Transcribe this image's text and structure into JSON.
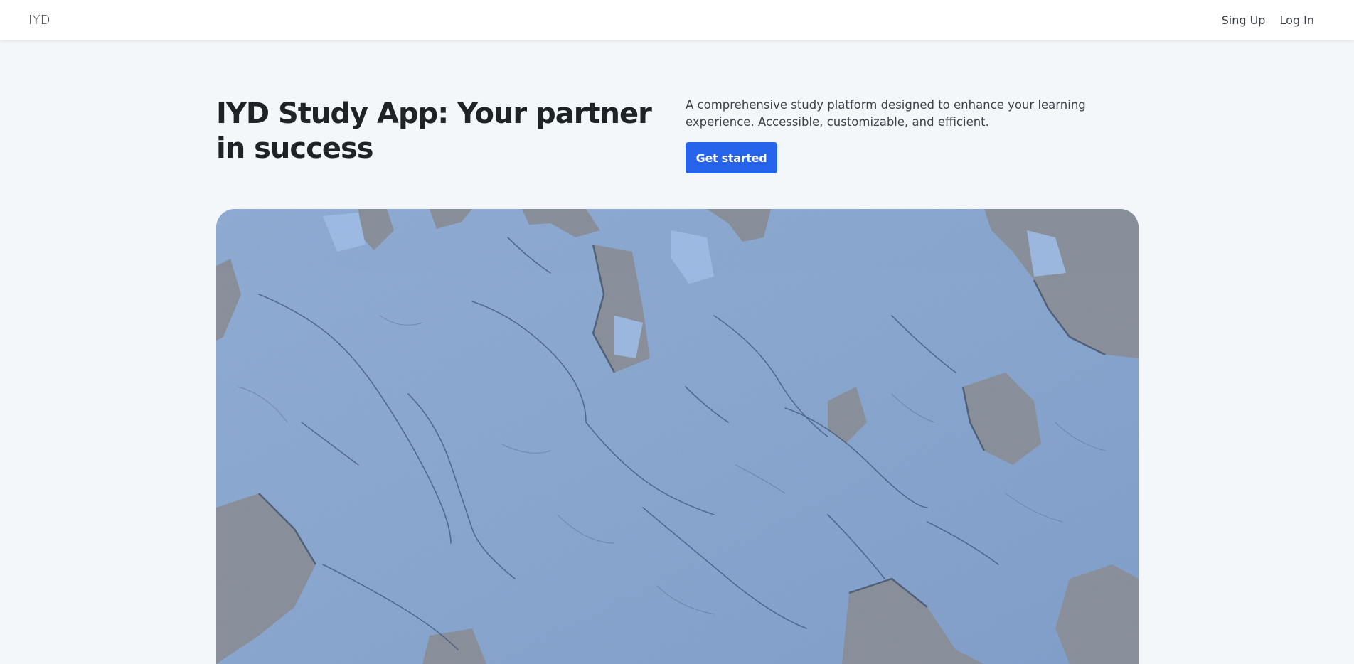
{
  "navbar": {
    "brand": "IYD",
    "links": [
      {
        "label": "Sing Up"
      },
      {
        "label": "Log In"
      }
    ]
  },
  "hero": {
    "title": "IYD Study App: Your partner in success",
    "description": "A comprehensive study platform designed to enhance your learning experience. Accessible, customizable, and efficient.",
    "cta_label": "Get started"
  },
  "colors": {
    "accent": "#2563eb",
    "page_background": "#f4f7fa",
    "paint_blue": "#8fb0dc",
    "concrete_gray": "#8a8f99"
  }
}
